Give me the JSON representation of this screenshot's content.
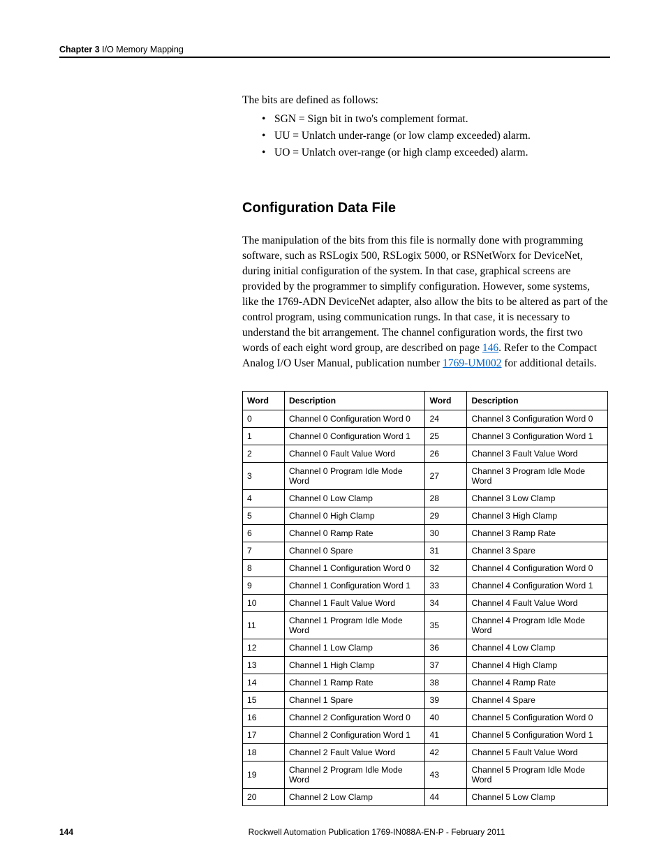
{
  "header": {
    "chapter_label": "Chapter 3",
    "chapter_title": "I/O Memory Mapping"
  },
  "intro_text": "The bits are defined as follows:",
  "bullets": [
    "SGN = Sign bit in two's complement format.",
    "UU = Unlatch under-range (or low clamp exceeded) alarm.",
    "UO = Unlatch over-range (or high clamp exceeded) alarm."
  ],
  "section_heading": "Configuration Data File",
  "paragraph": {
    "p1": "The manipulation of the bits from this file is normally done with programming software, such as RSLogix 500, RSLogix 5000, or RSNetWorx for DeviceNet, during initial configuration of the system. In that case, graphical screens are provided by the programmer to simplify configuration. However, some systems, like the 1769-ADN DeviceNet adapter, also allow the bits to be altered as part of the control program, using communication rungs. In that case, it is necessary to understand the bit arrangement. The channel configuration words, the first two words of each eight word group, are described on page ",
    "link1": "146",
    "p2": ". Refer to the Compact Analog I/O User Manual, publication number ",
    "link2": "1769-UM002",
    "p3": " for additional details."
  },
  "table": {
    "headers": {
      "word": "Word",
      "desc": "Description"
    },
    "rows": [
      {
        "w1": "0",
        "d1": "Channel 0 Configuration Word 0",
        "w2": "24",
        "d2": "Channel 3 Configuration Word 0"
      },
      {
        "w1": "1",
        "d1": "Channel 0 Configuration Word 1",
        "w2": "25",
        "d2": "Channel 3 Configuration Word 1"
      },
      {
        "w1": "2",
        "d1": "Channel 0 Fault Value Word",
        "w2": "26",
        "d2": "Channel 3 Fault Value Word"
      },
      {
        "w1": "3",
        "d1": "Channel 0 Program Idle Mode Word",
        "w2": "27",
        "d2": "Channel 3 Program Idle Mode Word"
      },
      {
        "w1": "4",
        "d1": "Channel 0 Low Clamp",
        "w2": "28",
        "d2": "Channel 3 Low Clamp"
      },
      {
        "w1": "5",
        "d1": "Channel 0 High Clamp",
        "w2": "29",
        "d2": "Channel 3 High Clamp"
      },
      {
        "w1": "6",
        "d1": "Channel 0 Ramp Rate",
        "w2": "30",
        "d2": "Channel 3 Ramp Rate"
      },
      {
        "w1": "7",
        "d1": "Channel 0 Spare",
        "w2": "31",
        "d2": "Channel 3 Spare"
      },
      {
        "w1": "8",
        "d1": "Channel 1 Configuration Word 0",
        "w2": "32",
        "d2": "Channel 4 Configuration Word 0"
      },
      {
        "w1": "9",
        "d1": "Channel 1 Configuration Word 1",
        "w2": "33",
        "d2": "Channel 4 Configuration Word 1"
      },
      {
        "w1": "10",
        "d1": "Channel 1 Fault Value Word",
        "w2": "34",
        "d2": "Channel 4 Fault Value Word"
      },
      {
        "w1": "11",
        "d1": "Channel 1 Program Idle Mode Word",
        "w2": "35",
        "d2": "Channel 4 Program Idle Mode Word"
      },
      {
        "w1": "12",
        "d1": "Channel 1 Low Clamp",
        "w2": "36",
        "d2": "Channel 4 Low Clamp"
      },
      {
        "w1": "13",
        "d1": "Channel 1 High Clamp",
        "w2": "37",
        "d2": "Channel 4 High Clamp"
      },
      {
        "w1": "14",
        "d1": "Channel 1 Ramp Rate",
        "w2": "38",
        "d2": "Channel 4 Ramp Rate"
      },
      {
        "w1": "15",
        "d1": "Channel 1 Spare",
        "w2": "39",
        "d2": "Channel 4 Spare"
      },
      {
        "w1": "16",
        "d1": "Channel 2 Configuration Word 0",
        "w2": "40",
        "d2": "Channel 5 Configuration Word 0"
      },
      {
        "w1": "17",
        "d1": "Channel 2 Configuration Word 1",
        "w2": "41",
        "d2": "Channel 5 Configuration Word 1"
      },
      {
        "w1": "18",
        "d1": "Channel 2 Fault Value Word",
        "w2": "42",
        "d2": "Channel 5 Fault Value Word"
      },
      {
        "w1": "19",
        "d1": "Channel 2 Program Idle Mode Word",
        "w2": "43",
        "d2": "Channel 5 Program Idle Mode Word"
      },
      {
        "w1": "20",
        "d1": "Channel 2 Low Clamp",
        "w2": "44",
        "d2": "Channel 5 Low Clamp"
      }
    ]
  },
  "footer": {
    "page_num": "144",
    "publication": "Rockwell Automation Publication 1769-IN088A-EN-P - February 2011"
  }
}
